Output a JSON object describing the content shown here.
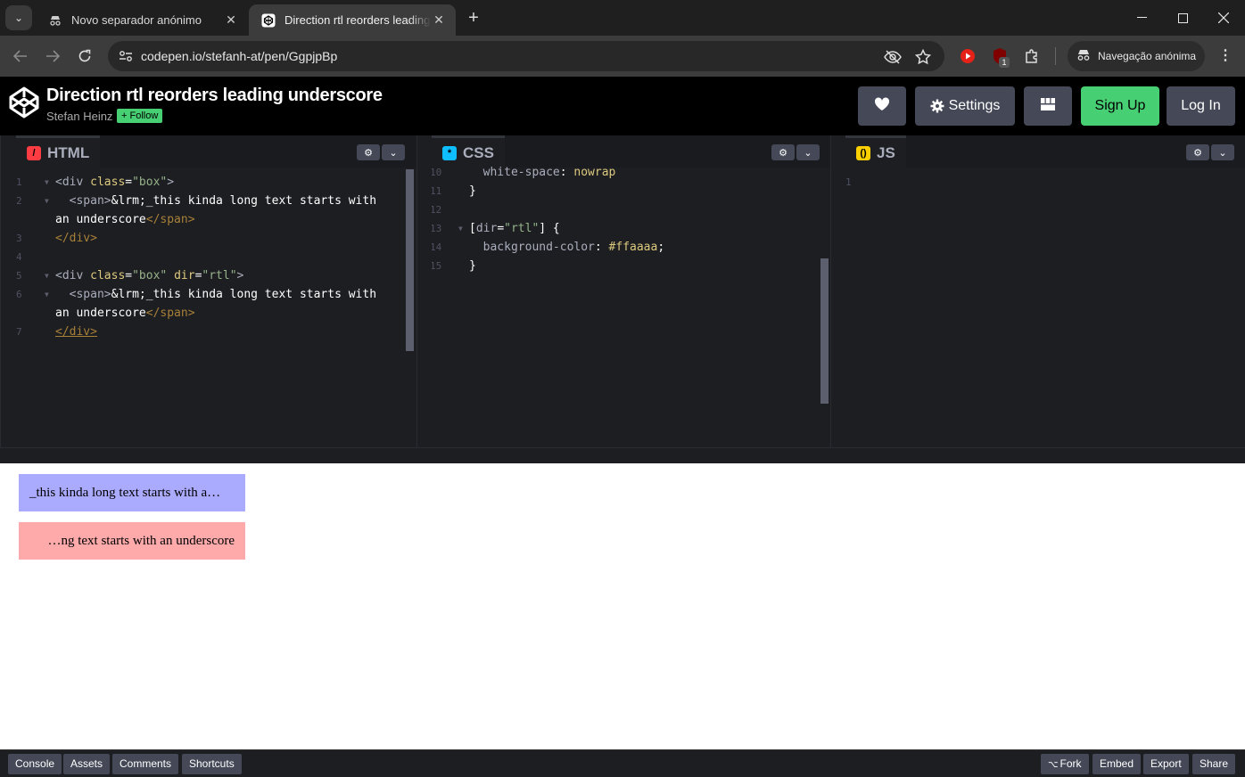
{
  "browser": {
    "tabs": [
      {
        "title": "Novo separador anónimo",
        "icon": "incognito-icon",
        "active": false
      },
      {
        "title": "Direction rtl reorders leading underscore",
        "icon": "codepen-icon",
        "active": true
      }
    ],
    "url": "codepen.io/stefanh-at/pen/GgpjpBp",
    "incognito_label": "Navegação anónima",
    "extension_badge": "1"
  },
  "pen": {
    "title": "Direction rtl reorders leading underscore",
    "author": "Stefan Heinz",
    "follow_label": "+ Follow",
    "buttons": {
      "settings": "Settings",
      "signup": "Sign Up",
      "login": "Log In"
    }
  },
  "editors": {
    "html": {
      "label": "HTML",
      "lines": [
        {
          "n": "1",
          "fold": true
        },
        {
          "n": "2",
          "fold": true
        },
        {
          "n": "",
          "fold": false
        },
        {
          "n": "3",
          "fold": false
        },
        {
          "n": "4",
          "fold": false
        },
        {
          "n": "5",
          "fold": true
        },
        {
          "n": "6",
          "fold": true
        },
        {
          "n": "",
          "fold": false
        },
        {
          "n": "7",
          "fold": false
        }
      ],
      "code": {
        "l1_tag_open": "<div ",
        "l1_attr": "class",
        "l1_eq": "=",
        "l1_val": "\"box\"",
        "l1_close": ">",
        "l2_span": "  <span>",
        "l2_text": "&lrm;_this kinda long text starts with",
        "l2b_text": "an underscore",
        "l2b_close": "</span>",
        "l3": "</div>",
        "l5_tag_open": "<div ",
        "l5_attr1": "class",
        "l5_eq1": "=",
        "l5_val1": "\"box\"",
        "l5_attr2": " dir",
        "l5_eq2": "=",
        "l5_val2": "\"rtl\"",
        "l5_close": ">",
        "l6_span": "  <span>",
        "l6_text": "&lrm;_this kinda long text starts with",
        "l6b_text": "an underscore",
        "l6b_close": "</span>",
        "l7": "</div>"
      }
    },
    "css": {
      "label": "CSS",
      "lines": [
        {
          "n": "10",
          "fold": false
        },
        {
          "n": "11",
          "fold": false
        },
        {
          "n": "12",
          "fold": false
        },
        {
          "n": "13",
          "fold": true
        },
        {
          "n": "14",
          "fold": false
        },
        {
          "n": "15",
          "fold": false
        }
      ],
      "code": {
        "l10_prop": "  white-space",
        "l10_colon": ": ",
        "l10_val": "nowrap",
        "l11": "}",
        "l13_open": "[",
        "l13_attr": "dir",
        "l13_eq": "=",
        "l13_val": "\"rtl\"",
        "l13_close": "] {",
        "l14_prop": "  background-color",
        "l14_colon": ": ",
        "l14_val": "#ffaaaa",
        "l14_semi": ";",
        "l15": "}"
      }
    },
    "js": {
      "label": "JS",
      "lines": [
        {
          "n": "1",
          "fold": false
        }
      ]
    }
  },
  "preview": {
    "box1_text": "_this kinda long text starts with a…",
    "box2_text": "…ng text starts with an underscore",
    "box1_color": "#aaaaff",
    "box2_color": "#ffaaaa"
  },
  "footer": {
    "left": [
      "Console",
      "Assets",
      "Comments",
      "Shortcuts"
    ],
    "right": [
      "Fork",
      "Embed",
      "Export",
      "Share"
    ]
  }
}
